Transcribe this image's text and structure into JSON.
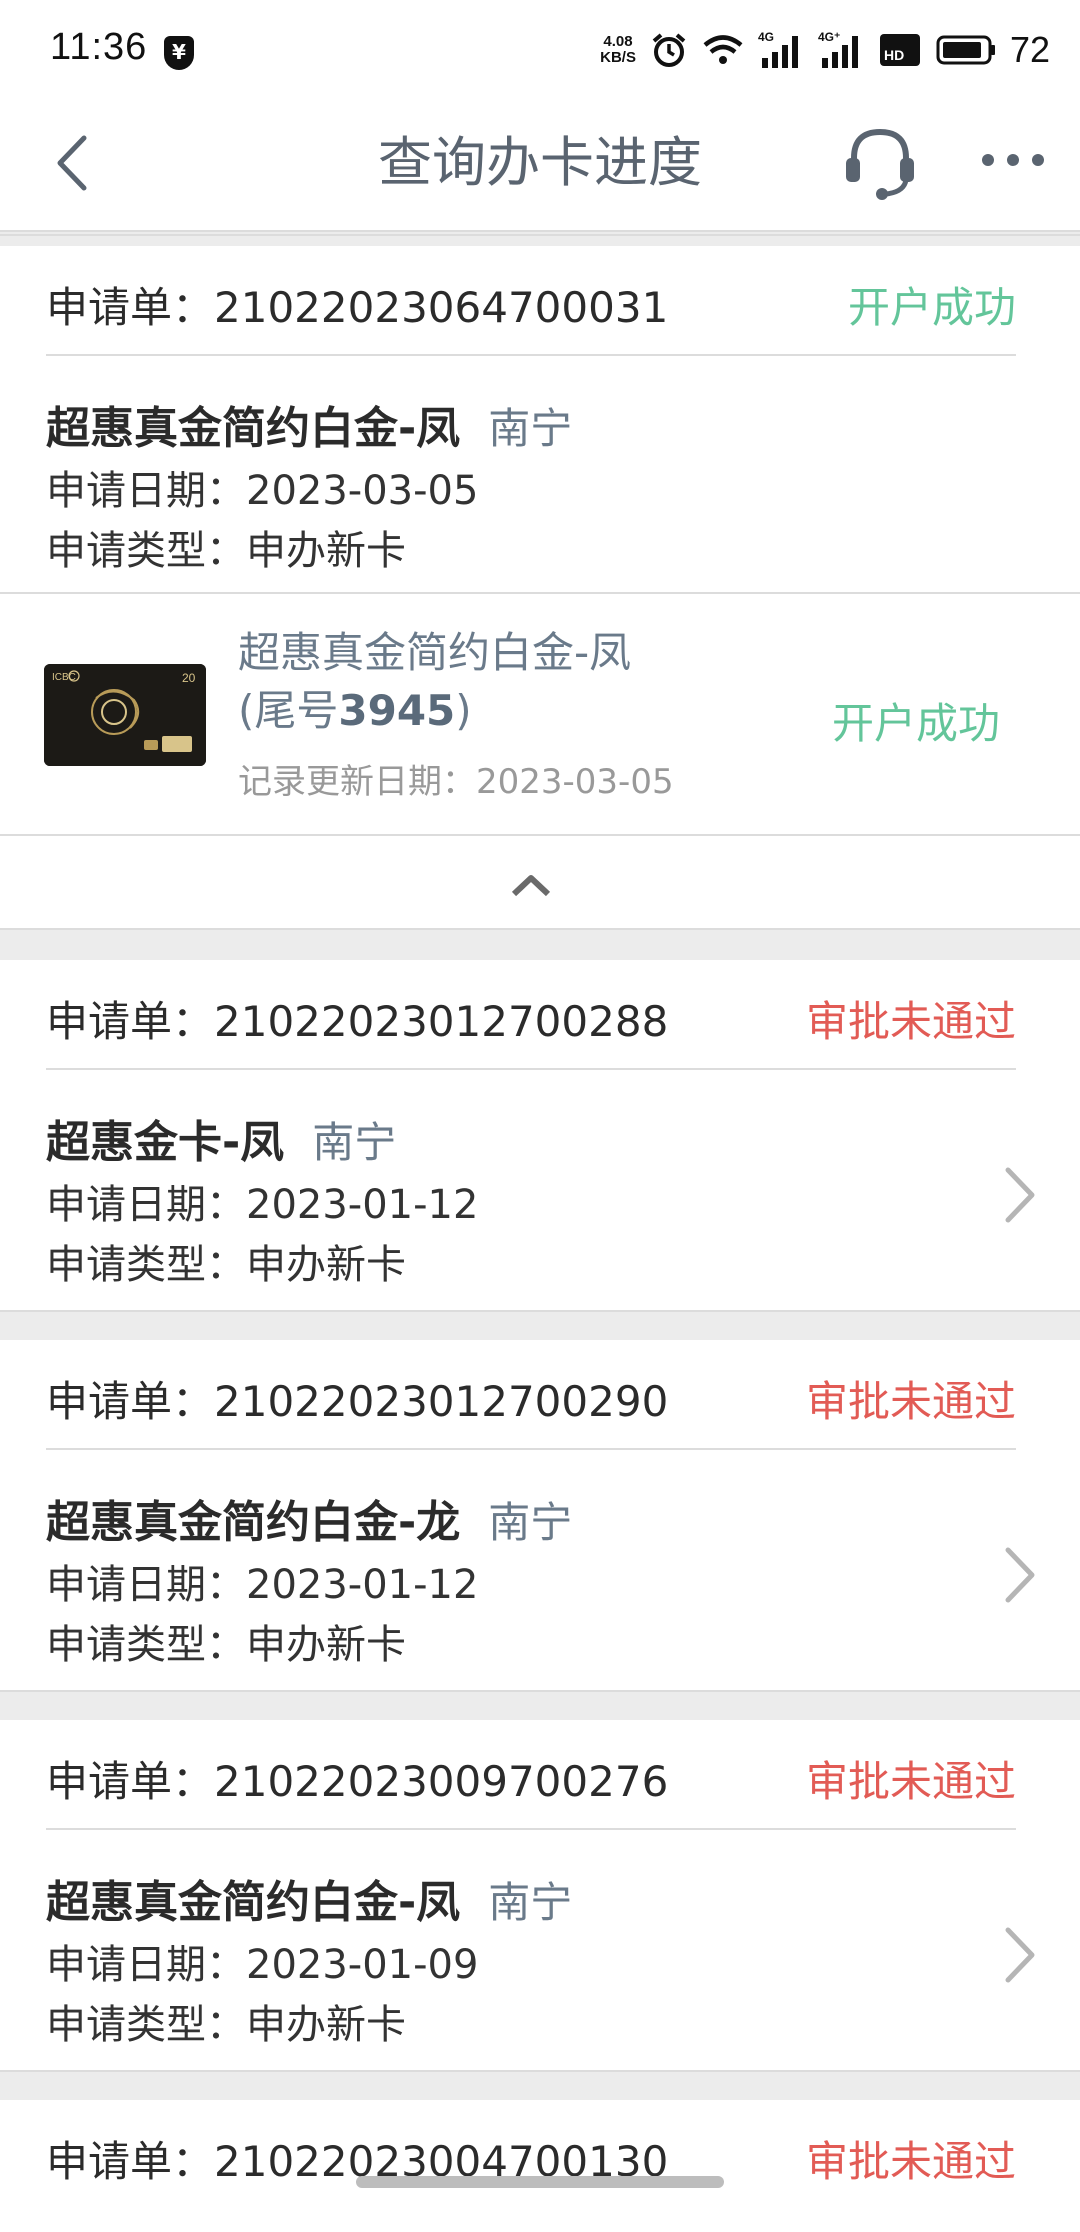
{
  "status_bar": {
    "time": "11:36",
    "speed_value": "4.08",
    "speed_unit": "KB/S",
    "net1": "4G",
    "net2": "4G⁺",
    "battery": "72"
  },
  "header": {
    "title": "查询办卡进度"
  },
  "applications": [
    {
      "order_label": "申请单：",
      "order_no": "21022023064700031",
      "status": "开户成功",
      "status_type": "ok",
      "card_name": "超惠真金简约白金-凤",
      "city": "南宁",
      "date_text": "申请日期：2023-03-05",
      "type_text": "申请类型：申办新卡",
      "expanded": true,
      "sub": {
        "name_line1": "超惠真金简约白金-凤",
        "name_prefix": "(尾号",
        "tail_no": "3945",
        "name_suffix": ")",
        "update_text": "记录更新日期：2023-03-05",
        "status": "开户成功"
      }
    },
    {
      "order_label": "申请单：",
      "order_no": "21022023012700288",
      "status": "审批未通过",
      "status_type": "fail",
      "card_name": "超惠金卡-凤",
      "city": "南宁",
      "date_text": "申请日期：2023-01-12",
      "type_text": "申请类型：申办新卡"
    },
    {
      "order_label": "申请单：",
      "order_no": "21022023012700290",
      "status": "审批未通过",
      "status_type": "fail",
      "card_name": "超惠真金简约白金-龙",
      "city": "南宁",
      "date_text": "申请日期：2023-01-12",
      "type_text": "申请类型：申办新卡"
    },
    {
      "order_label": "申请单：",
      "order_no": "21022023009700276",
      "status": "审批未通过",
      "status_type": "fail",
      "card_name": "超惠真金简约白金-凤",
      "city": "南宁",
      "date_text": "申请日期：2023-01-09",
      "type_text": "申请类型：申办新卡"
    },
    {
      "order_label": "申请单：",
      "order_no": "21022023004700130",
      "status": "审批未通过",
      "status_type": "fail"
    }
  ],
  "colors": {
    "success": "#63c59a",
    "failure": "#e25b55",
    "title": "#5a6470"
  },
  "icons": [
    "chevron-left-icon",
    "headset-icon",
    "more-icon",
    "chevron-up-icon",
    "chevron-right-icon"
  ]
}
